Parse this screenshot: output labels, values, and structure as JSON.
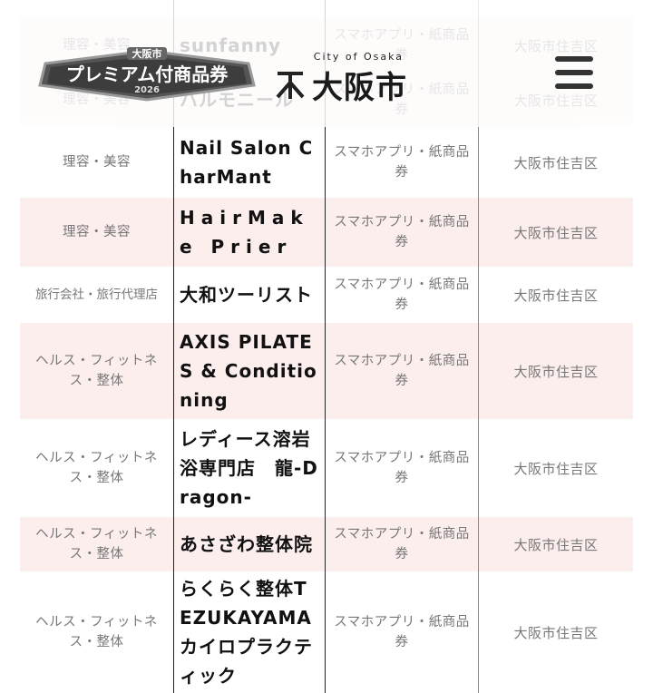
{
  "header": {
    "badge_top": "大阪市",
    "badge_main": "プレミアム付商品券",
    "badge_year": "2026",
    "logo_city": "City of Osaka",
    "logo_jp": "大阪市"
  },
  "rows": [
    {
      "category": "",
      "name": "",
      "ticket": "券",
      "area": "",
      "pink": false,
      "faded": true
    },
    {
      "category": "理容・美容",
      "name": "sunfanny",
      "ticket": "スマホアプリ・紙商品券",
      "area": "大阪市住吉区",
      "pink": true,
      "faded": true
    },
    {
      "category": "理容・美容",
      "name": "ハルモニール",
      "ticket": "スマホアプリ・紙商品券",
      "area": "大阪市住吉区",
      "pink": true,
      "faded": true
    },
    {
      "category": "理容・美容",
      "name": "Nail Salon CharMant",
      "ticket": "スマホアプリ・紙商品券",
      "area": "大阪市住吉区",
      "pink": false,
      "faded": false
    },
    {
      "category": "理容・美容",
      "name": "HairMake Prier",
      "ticket": "スマホアプリ・紙商品券",
      "area": "大阪市住吉区",
      "pink": true,
      "faded": false
    },
    {
      "category": "旅行会社・旅行代理店",
      "name": "大和ツーリスト",
      "ticket": "スマホアプリ・紙商品券",
      "area": "大阪市住吉区",
      "pink": false,
      "faded": false
    },
    {
      "category": "ヘルス・フィットネス・整体",
      "name": "AXIS PILATES & Conditioning",
      "ticket": "スマホアプリ・紙商品券",
      "area": "大阪市住吉区",
      "pink": true,
      "faded": false
    },
    {
      "category": "ヘルス・フィットネス・整体",
      "name": "レディース溶岩浴専門店　龍-Dragon-",
      "ticket": "スマホアプリ・紙商品券",
      "area": "大阪市住吉区",
      "pink": false,
      "faded": false
    },
    {
      "category": "ヘルス・フィットネス・整体",
      "name": "あさざわ整体院",
      "ticket": "スマホアプリ・紙商品券",
      "area": "大阪市住吉区",
      "pink": true,
      "faded": false
    },
    {
      "category": "ヘルス・フィットネス・整体",
      "name": "らくらく整体TEZUKAYAMAカイロプラクティック",
      "ticket": "スマホアプリ・紙商品券",
      "area": "大阪市住吉区",
      "pink": false,
      "faded": false
    }
  ]
}
